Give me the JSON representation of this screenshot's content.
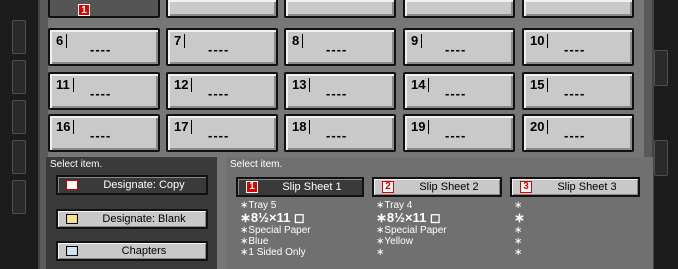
{
  "grid": {
    "top_row": [
      {
        "num": "1",
        "val": "",
        "active": true
      },
      {
        "num": "",
        "val": ""
      },
      {
        "num": "",
        "val": ""
      },
      {
        "num": "",
        "val": ""
      },
      {
        "num": "",
        "val": ""
      }
    ],
    "rows": [
      [
        {
          "num": "6",
          "val": "----"
        },
        {
          "num": "7",
          "val": "----"
        },
        {
          "num": "8",
          "val": "----"
        },
        {
          "num": "9",
          "val": "----"
        },
        {
          "num": "10",
          "val": "----"
        }
      ],
      [
        {
          "num": "11",
          "val": "----"
        },
        {
          "num": "12",
          "val": "----"
        },
        {
          "num": "13",
          "val": "----"
        },
        {
          "num": "14",
          "val": "----"
        },
        {
          "num": "15",
          "val": "----"
        }
      ],
      [
        {
          "num": "16",
          "val": "----"
        },
        {
          "num": "17",
          "val": "----"
        },
        {
          "num": "18",
          "val": "----"
        },
        {
          "num": "19",
          "val": "----"
        },
        {
          "num": "20",
          "val": "----"
        }
      ]
    ]
  },
  "left_panel": {
    "label": "Select item.",
    "buttons": [
      {
        "label": "Designate: Copy",
        "icon": "copy-doc-icon",
        "selected": true
      },
      {
        "label": "Designate: Blank",
        "icon": "blank-doc-icon",
        "selected": false
      },
      {
        "label": "Chapters",
        "icon": "chapters-icon",
        "selected": false
      }
    ]
  },
  "right_panel": {
    "label": "Select item.",
    "slip_sheets": [
      {
        "num": "1",
        "label": "Slip Sheet 1",
        "selected": true,
        "info": [
          "∗Tray 5",
          "∗8½×11 ◻",
          "∗Special Paper",
          "∗Blue",
          "∗1 Sided Only"
        ]
      },
      {
        "num": "2",
        "label": "Slip Sheet 2",
        "selected": false,
        "info": [
          "∗Tray 4",
          "∗8½×11 ◻",
          "∗Special Paper",
          "∗Yellow",
          "∗"
        ]
      },
      {
        "num": "3",
        "label": "Slip Sheet 3",
        "selected": false,
        "info": [
          "∗",
          "∗",
          "∗",
          "∗",
          "∗"
        ]
      }
    ]
  },
  "colors": {
    "accent_red": "#d00000",
    "panel_dark": "#3a3a3a",
    "button_face": "#c8c8c8"
  }
}
